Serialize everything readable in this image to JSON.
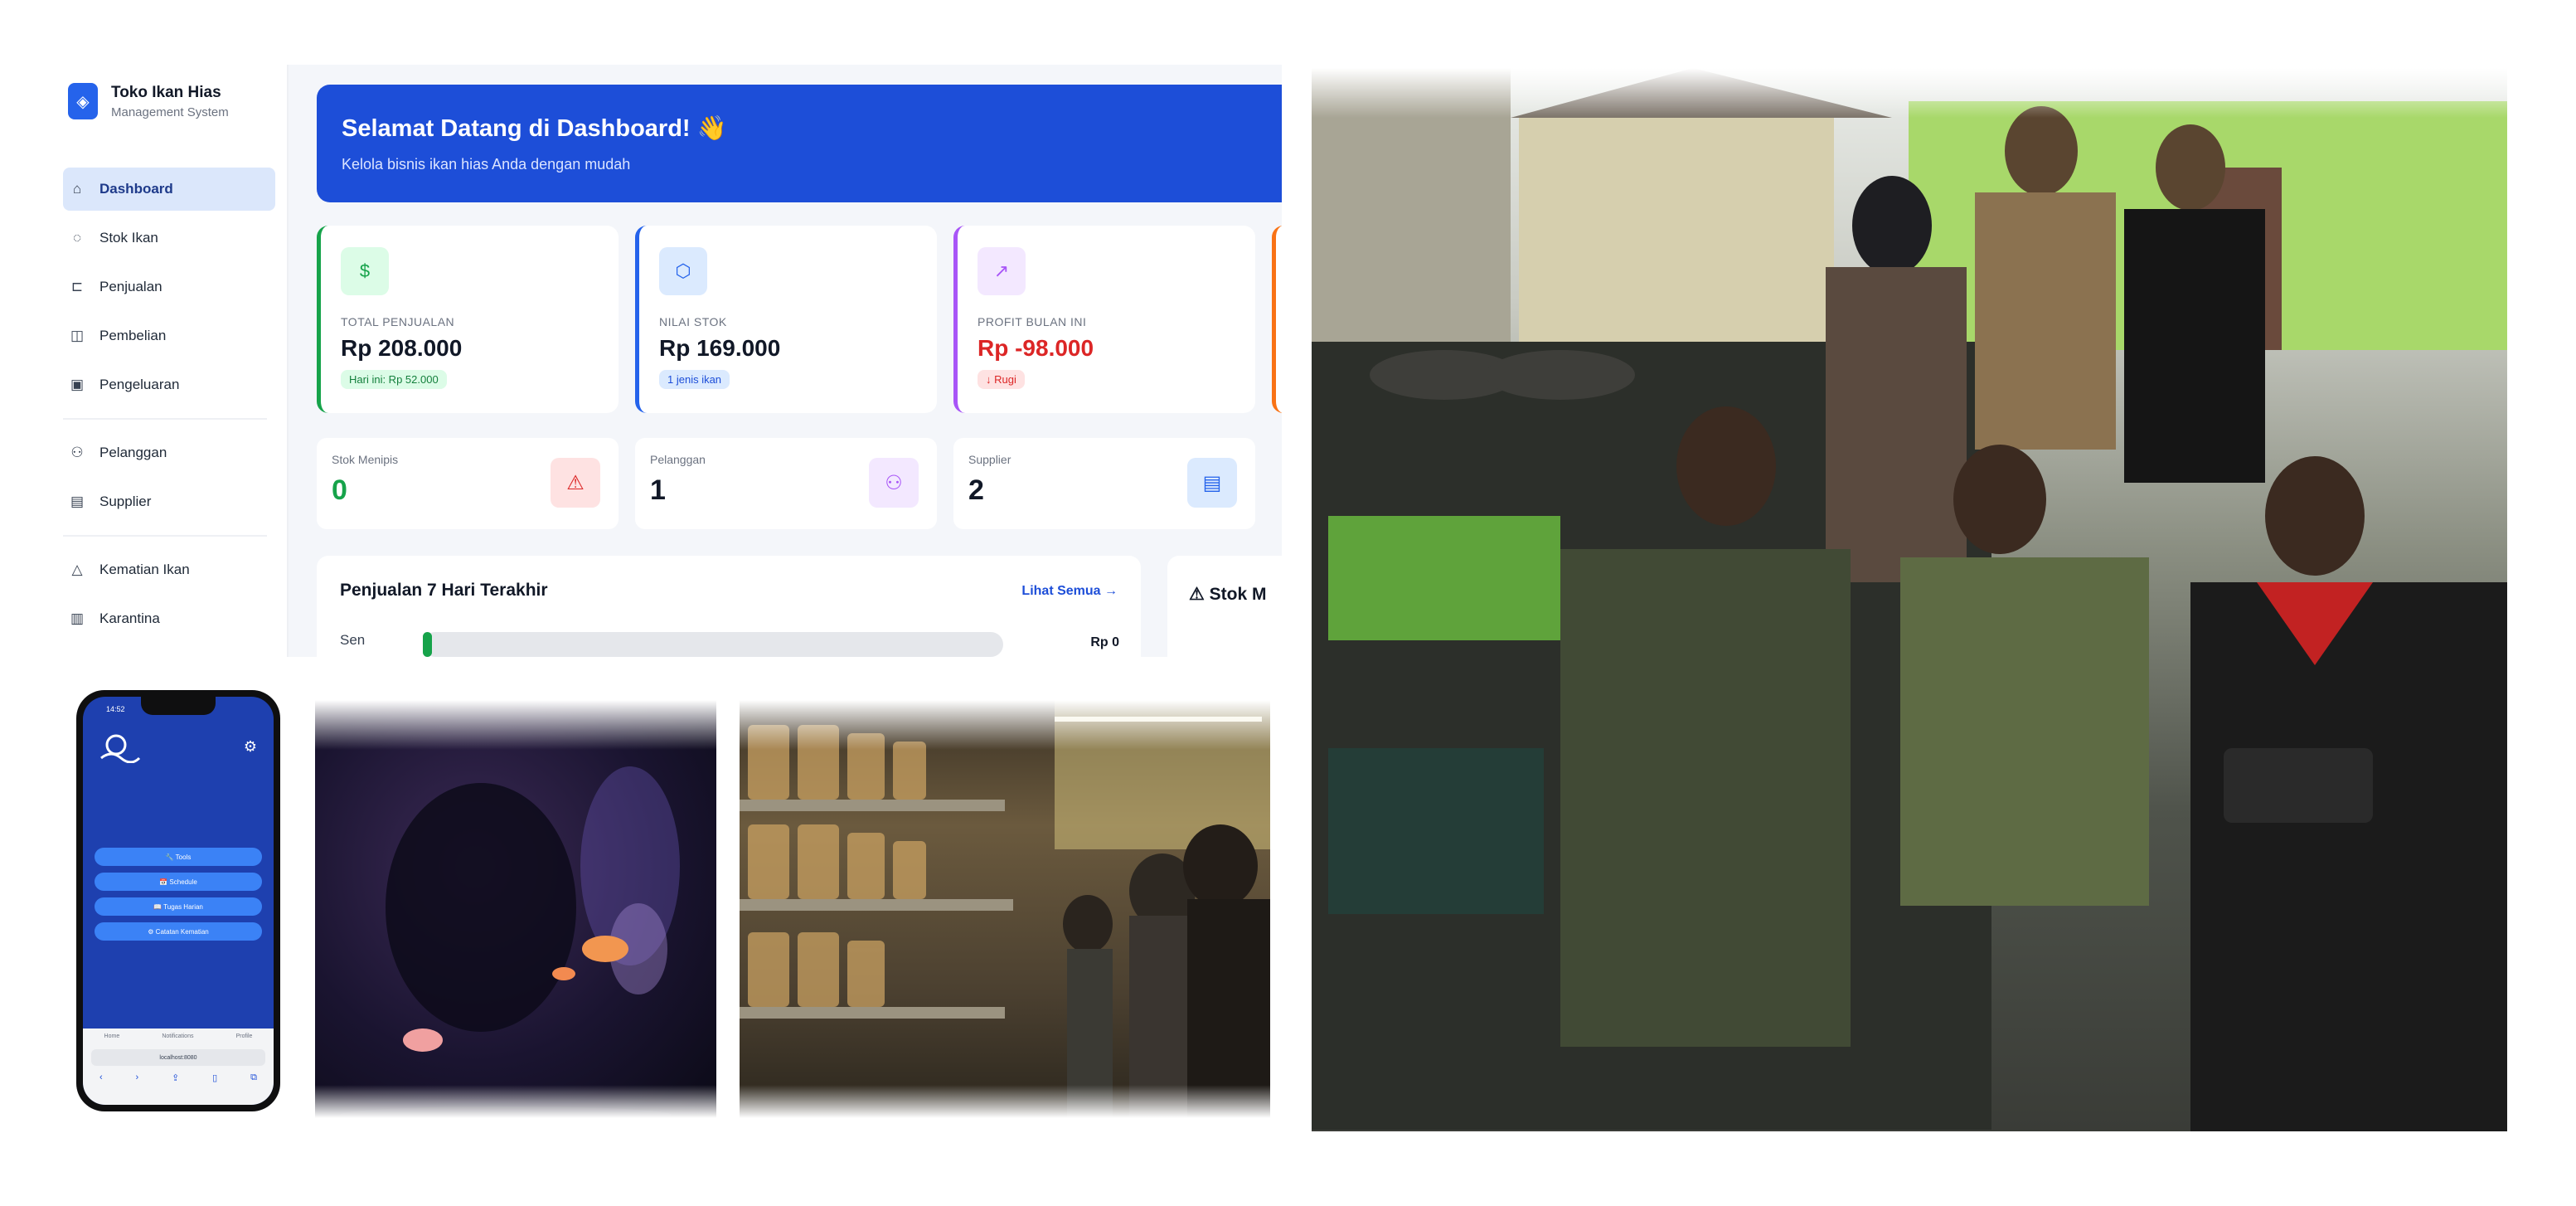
{
  "sidebar": {
    "brand_name": "Toko Ikan Hias",
    "brand_sub": "Management System",
    "items": [
      {
        "label": "Dashboard",
        "icon": "home-icon"
      },
      {
        "label": "Stok Ikan",
        "icon": "fish-icon"
      },
      {
        "label": "Penjualan",
        "icon": "cart-icon"
      },
      {
        "label": "Pembelian",
        "icon": "bag-icon"
      },
      {
        "label": "Pengeluaran",
        "icon": "wallet-icon"
      },
      {
        "label": "Pelanggan",
        "icon": "users-icon"
      },
      {
        "label": "Supplier",
        "icon": "building-icon"
      },
      {
        "label": "Kematian Ikan",
        "icon": "alert-icon"
      },
      {
        "label": "Karantina",
        "icon": "quarantine-icon"
      }
    ]
  },
  "banner": {
    "title": "Selamat Datang di Dashboard! 👋",
    "subtitle": "Kelola bisnis ikan hias Anda dengan mudah",
    "color": "#1d4ed8"
  },
  "cards": [
    {
      "label": "Total Penjualan",
      "value": "Rp 208.000",
      "badge": "Hari ini: Rp 52.000",
      "accent": "#16a34a",
      "icon": "dollar-icon"
    },
    {
      "label": "Nilai Stok",
      "value": "Rp 169.000",
      "badge": "1 jenis ikan",
      "accent": "#2563eb",
      "icon": "box-icon"
    },
    {
      "label": "Profit Bulan Ini",
      "value": "Rp -98.000",
      "badge": "↓ Rugi",
      "accent": "#a855f7",
      "value_color": "#dc2626",
      "icon": "trend-icon"
    }
  ],
  "mini_stats": [
    {
      "label": "Stok Menipis",
      "value": "0",
      "value_color": "#16a34a",
      "icon": "warning-icon"
    },
    {
      "label": "Pelanggan",
      "value": "1",
      "icon": "users-icon"
    },
    {
      "label": "Supplier",
      "value": "2",
      "icon": "building-icon"
    }
  ],
  "sales_panel": {
    "title": "Penjualan 7 Hari Terakhir",
    "link": "Lihat Semua →",
    "rows": [
      {
        "day": "Sen",
        "value": "Rp 0",
        "fraction": 0.01
      }
    ]
  },
  "stock_panel": {
    "title": "⚠ Stok M"
  },
  "phone": {
    "time": "14:52",
    "buttons": [
      "🔧 Tools",
      "📅 Schedule",
      "📖 Tugas Harian",
      "⚙ Catatan Kematian"
    ],
    "tabs": [
      "Home",
      "Notifications",
      "Profile"
    ],
    "url": "localhost:8080"
  }
}
